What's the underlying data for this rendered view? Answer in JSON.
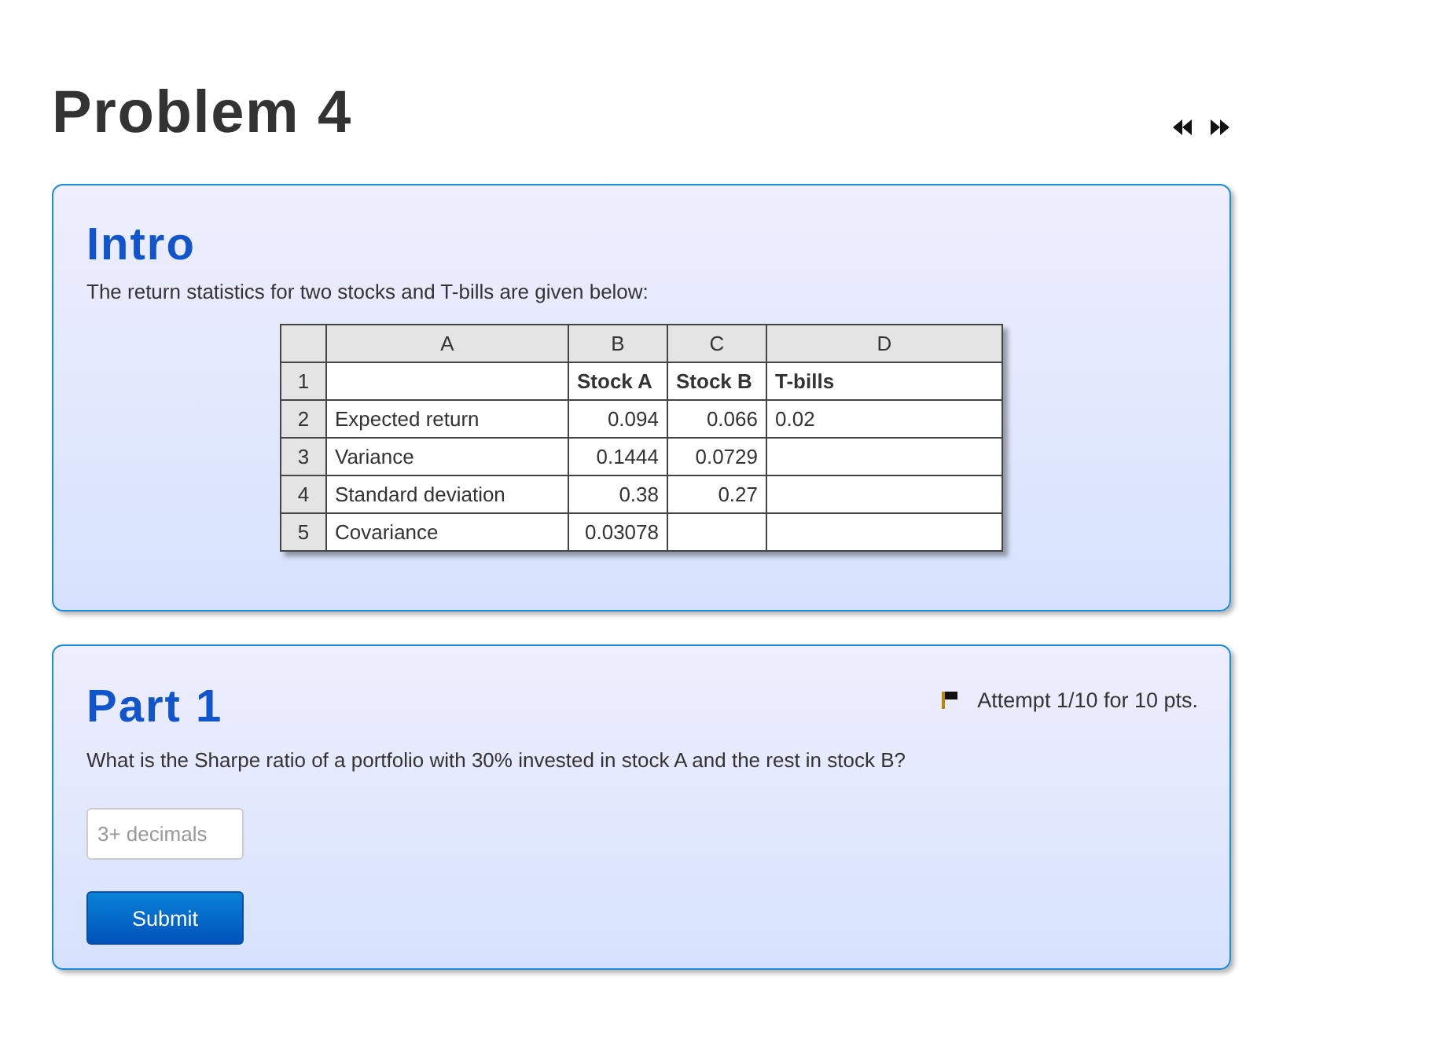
{
  "page": {
    "title": "Problem 4"
  },
  "intro": {
    "heading": "Intro",
    "text": "The return statistics for two stocks and T-bills are given below:",
    "spreadsheet": {
      "columns": [
        "A",
        "B",
        "C",
        "D"
      ],
      "rows": [
        {
          "number": "1",
          "kind": "header",
          "cells": [
            null,
            "Stock A",
            "Stock B",
            "T-bills"
          ]
        },
        {
          "number": "2",
          "kind": "data",
          "cells": [
            "Expected return",
            "0.094",
            "0.066",
            "0.02"
          ]
        },
        {
          "number": "3",
          "kind": "data",
          "cells": [
            "Variance",
            "0.1444",
            "0.0729",
            null
          ]
        },
        {
          "number": "4",
          "kind": "data",
          "cells": [
            "Standard deviation",
            "0.38",
            "0.27",
            null
          ]
        },
        {
          "number": "5",
          "kind": "data",
          "cells": [
            "Covariance",
            "0.03078",
            null,
            null
          ]
        }
      ]
    }
  },
  "part": {
    "heading": "Part 1",
    "attempt": "Attempt 1/10 for 10 pts.",
    "question": "What is the Sharpe ratio of a portfolio with 30% invested in stock A and the rest in stock B?",
    "answer": {
      "placeholder": "3+ decimals"
    },
    "submit": "Submit"
  }
}
